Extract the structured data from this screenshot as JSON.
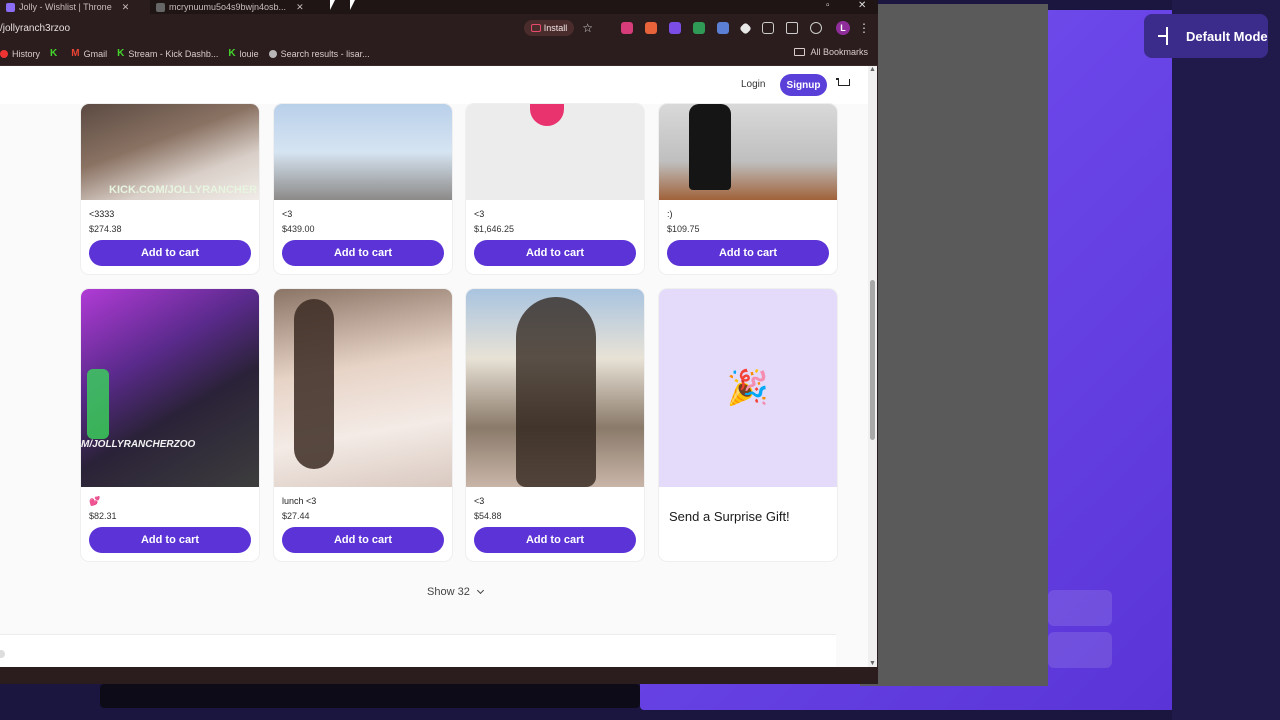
{
  "overlay": {
    "mode_label": "Default Mode",
    "colors": {
      "panel": "#6a45e8",
      "badge": "#3b2c8c"
    }
  },
  "browser": {
    "tabs": [
      {
        "label": "Jolly - Wishlist | Throne"
      },
      {
        "label": "mcrynuumu5o4s9bwjn4osb..."
      }
    ],
    "url": "/jollyranch3rzoo",
    "install_label": "Install",
    "profile_initial": "L",
    "bookmarks": [
      {
        "label": "History"
      },
      {
        "label": ""
      },
      {
        "label": "Gmail"
      },
      {
        "label": "Stream - Kick Dashb..."
      },
      {
        "label": "louie"
      },
      {
        "label": "Search results - lisar..."
      }
    ],
    "all_bookmarks": "All Bookmarks"
  },
  "site": {
    "login": "Login",
    "signup": "Signup",
    "accent": "#5b33d6",
    "add_to_cart": "Add to cart",
    "products_row1": [
      {
        "name": "<3333",
        "price": "$274.38"
      },
      {
        "name": "<3",
        "price": "$439.00"
      },
      {
        "name": "<3",
        "price": "$1,646.25"
      },
      {
        "name": ":)",
        "price": "$109.75"
      }
    ],
    "products_row2": [
      {
        "name": "💕",
        "price": "$82.31"
      },
      {
        "name": "lunch <3",
        "price": "$27.44"
      },
      {
        "name": "<3",
        "price": "$54.88"
      }
    ],
    "gift": {
      "icon": "🎉",
      "title": "Send a Surprise Gift!"
    },
    "photo_captions": {
      "row1_card1": "KICK.COM/JOLLYRANCHER",
      "row2_card1": "M/JOLLYRANCHERZOO"
    },
    "show_label": "Show 32"
  }
}
